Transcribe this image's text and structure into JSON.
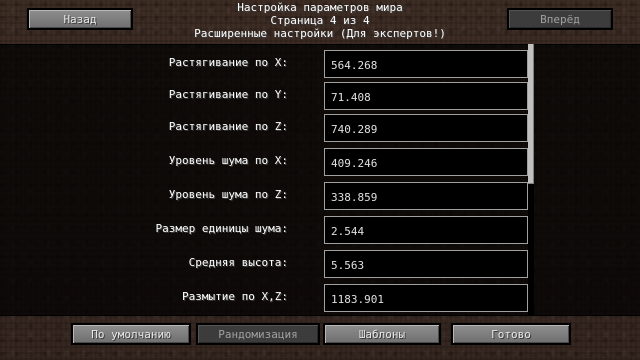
{
  "nav": {
    "back_label": "Назад",
    "next_label": "Вперёд"
  },
  "header": {
    "line1": "Настройка параметров мира",
    "line2": "Страница 4 из 4",
    "line3": "Расширенные настройки (Для экспертов!)"
  },
  "settings": [
    {
      "label": "Растягивание по X:",
      "value": "564.268"
    },
    {
      "label": "Растягивание по Y:",
      "value": "71.408"
    },
    {
      "label": "Растягивание по Z:",
      "value": "740.289"
    },
    {
      "label": "Уровень шума по X:",
      "value": "409.246"
    },
    {
      "label": "Уровень шума по Z:",
      "value": "338.859"
    },
    {
      "label": "Размер единицы шума:",
      "value": "2.544"
    },
    {
      "label": "Средняя высота:",
      "value": "5.563"
    },
    {
      "label": "Размытие по X,Z:",
      "value": "1183.901"
    }
  ],
  "footer": {
    "defaults_label": "По умолчанию",
    "randomize_label": "Рандомизация",
    "presets_label": "Шаблоны",
    "done_label": "Готово"
  }
}
